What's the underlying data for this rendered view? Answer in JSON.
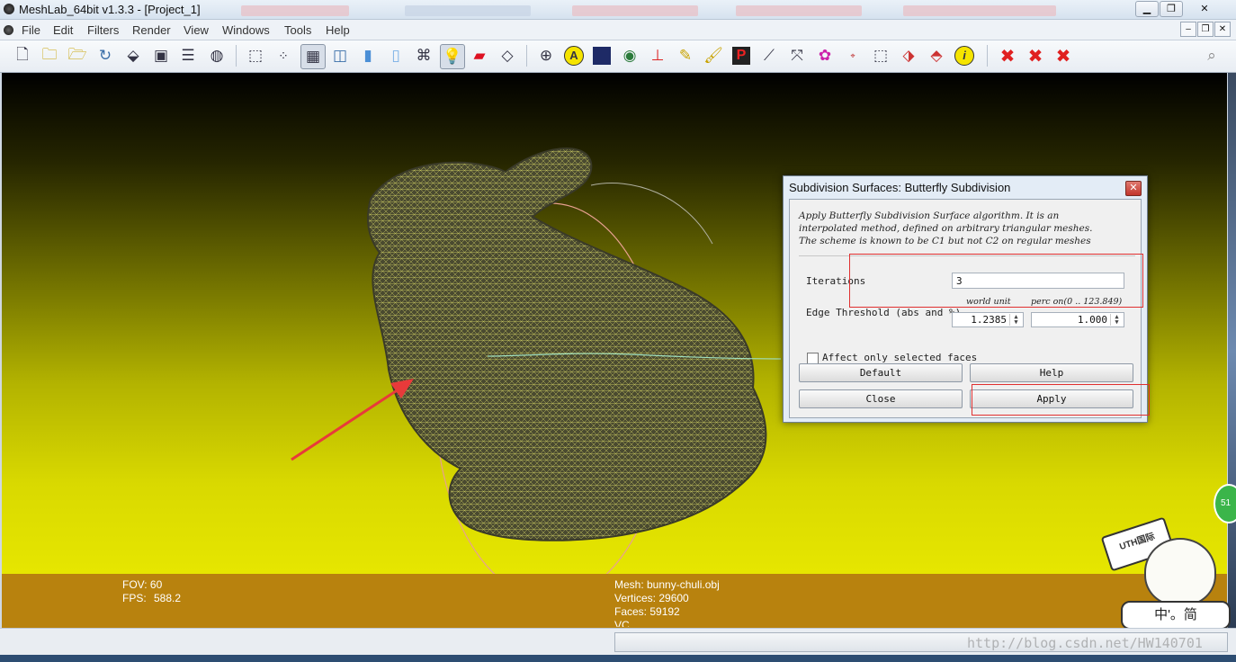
{
  "window": {
    "title": "MeshLab_64bit v1.3.3 - [Project_1]"
  },
  "menu": [
    "File",
    "Edit",
    "Filters",
    "Render",
    "View",
    "Windows",
    "Tools",
    "Help"
  ],
  "toolbar_icons": [
    "new-project-icon",
    "open-project-icon",
    "open-mesh-icon",
    "reload-icon",
    "export-icon",
    "snapshot-icon",
    "layers-icon",
    "globe-view-icon",
    "bbox-icon",
    "points-icon",
    "wireframe-icon",
    "hidden-lines-icon",
    "flat-icon",
    "smooth-icon",
    "texture-icon",
    "light-icon",
    "fancy-light-icon",
    "double-side-icon",
    "sphere-icon",
    "annotation-icon",
    "color-info-icon",
    "sphere-shading-icon",
    "axis-icon",
    "paint-icon",
    "brush-icon",
    "pick-points-icon",
    "measure-icon",
    "align-icon",
    "select-faces-icon",
    "reference-icon",
    "select-vertex-icon",
    "edit-icon",
    "delete-icon",
    "info-icon",
    "delete-faces-icon",
    "delete-vertices-icon",
    "delete-both-icon",
    "search-icon"
  ],
  "info": {
    "fov": "FOV: 60",
    "fps_label": "FPS:",
    "fps_value": "588.2",
    "mesh": "Mesh: bunny-chuli.obj",
    "vertices": "Vertices: 29600",
    "faces": "Faces: 59192",
    "vc": "VC"
  },
  "dialog": {
    "title": "Subdivision Surfaces: Butterfly Subdivision",
    "desc1": "Apply Butterfly Subdivision Surface algorithm. It is an",
    "desc2": "interpolated method, defined on arbitrary triangular meshes.",
    "desc3": "The scheme is known to be C1 but not C2 on regular meshes",
    "iterations_label": "Iterations",
    "iterations_value": "3",
    "world_unit_label": "world unit",
    "perc_label": "perc on(0 .. 123.849)",
    "edge_label": "Edge Threshold (abs and %)",
    "edge_abs": "1.2385",
    "edge_perc": "1.000",
    "affect_label": "Affect only selected faces",
    "affect_checked": false,
    "default_btn": "Default",
    "help_btn": "Help",
    "close_btn": "Close",
    "apply_btn": "Apply"
  },
  "watermark": "http://blog.csdn.net/HW140701",
  "sticker": {
    "brand": "UTH国际",
    "chars": "中'。简",
    "badge": "51"
  }
}
